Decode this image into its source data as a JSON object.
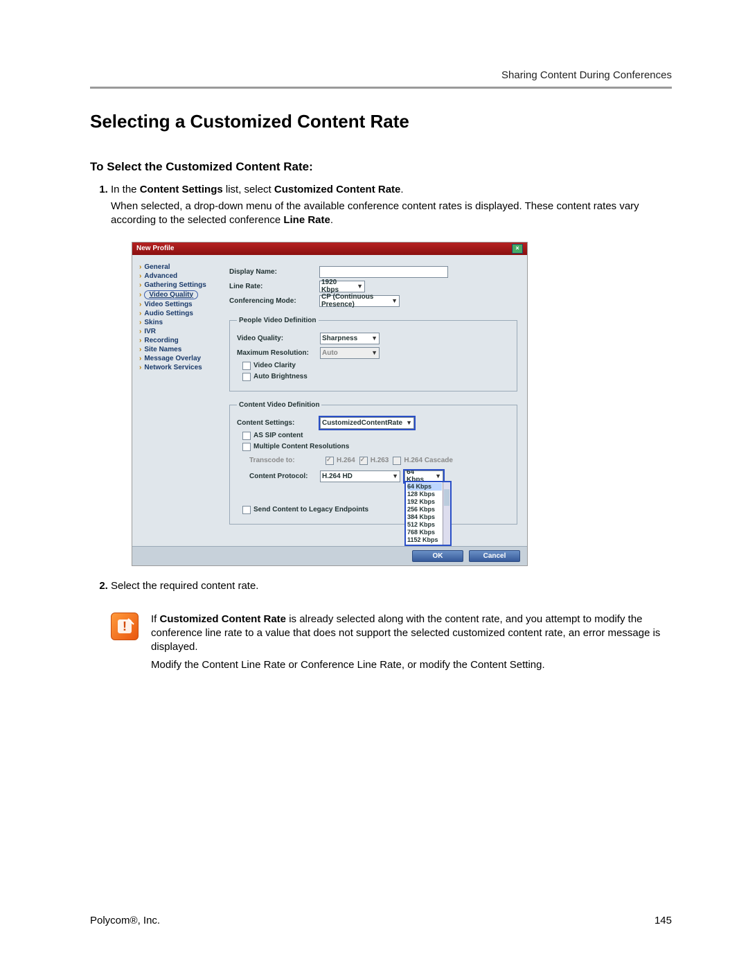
{
  "header": {
    "right": "Sharing Content During Conferences"
  },
  "h1": "Selecting a Customized Content Rate",
  "h2": "To Select the Customized Content Rate:",
  "step1_lead": "In the ",
  "step1_b1": "Content Settings",
  "step1_mid": " list, select ",
  "step1_b2": "Customized Content Rate",
  "step1_tail": ".",
  "step1_para_a": "When selected, a drop-down menu of the available conference content rates is displayed. These content rates vary according to the selected conference ",
  "step1_para_b": "Line Rate",
  "step1_para_c": ".",
  "dialog": {
    "title": "New Profile",
    "close": "×",
    "nav": [
      "General",
      "Advanced",
      "Gathering Settings",
      "Video Quality",
      "Video Settings",
      "Audio Settings",
      "Skins",
      "IVR",
      "Recording",
      "Site Names",
      "Message Overlay",
      "Network Services"
    ],
    "nav_selected_index": 3,
    "labels": {
      "display_name": "Display Name:",
      "line_rate": "Line Rate:",
      "conf_mode": "Conferencing Mode:",
      "people_legend": "People Video Definition",
      "video_quality": "Video Quality:",
      "max_res": "Maximum Resolution:",
      "video_clarity": "Video Clarity",
      "auto_bright": "Auto Brightness",
      "content_legend": "Content Video Definition",
      "content_settings": "Content Settings:",
      "as_sip": "AS SIP content",
      "mcr": "Multiple Content Resolutions",
      "transcode": "Transcode to:",
      "t1": "H.264",
      "t2": "H.263",
      "t3": "H.264 Cascade",
      "content_protocol": "Content Protocol:",
      "send_legacy": "Send Content to Legacy Endpoints"
    },
    "values": {
      "line_rate": "1920 Kbps",
      "conf_mode": "CP (Continuous Presence)",
      "video_quality": "Sharpness",
      "max_res": "Auto",
      "content_settings": "CustomizedContentRate",
      "content_protocol": "H.264 HD",
      "rate_sel": "64 Kbps"
    },
    "rates": [
      "64 Kbps",
      "128 Kbps",
      "192 Kbps",
      "256 Kbps",
      "384 Kbps",
      "512 Kbps",
      "768 Kbps",
      "1152 Kbps"
    ],
    "buttons": {
      "ok": "OK",
      "cancel": "Cancel"
    }
  },
  "step2": "Select the required content rate.",
  "note": {
    "p1a": "If ",
    "p1b": "Customized Content Rate",
    "p1c": " is already selected along with the content rate, and you attempt to modify the conference line rate to a value that does not support the selected customized content rate, an error message is displayed.",
    "p2": "Modify the Content Line Rate or Conference Line Rate, or modify the Content Setting."
  },
  "footer": {
    "left": "Polycom®, Inc.",
    "right": "145"
  }
}
